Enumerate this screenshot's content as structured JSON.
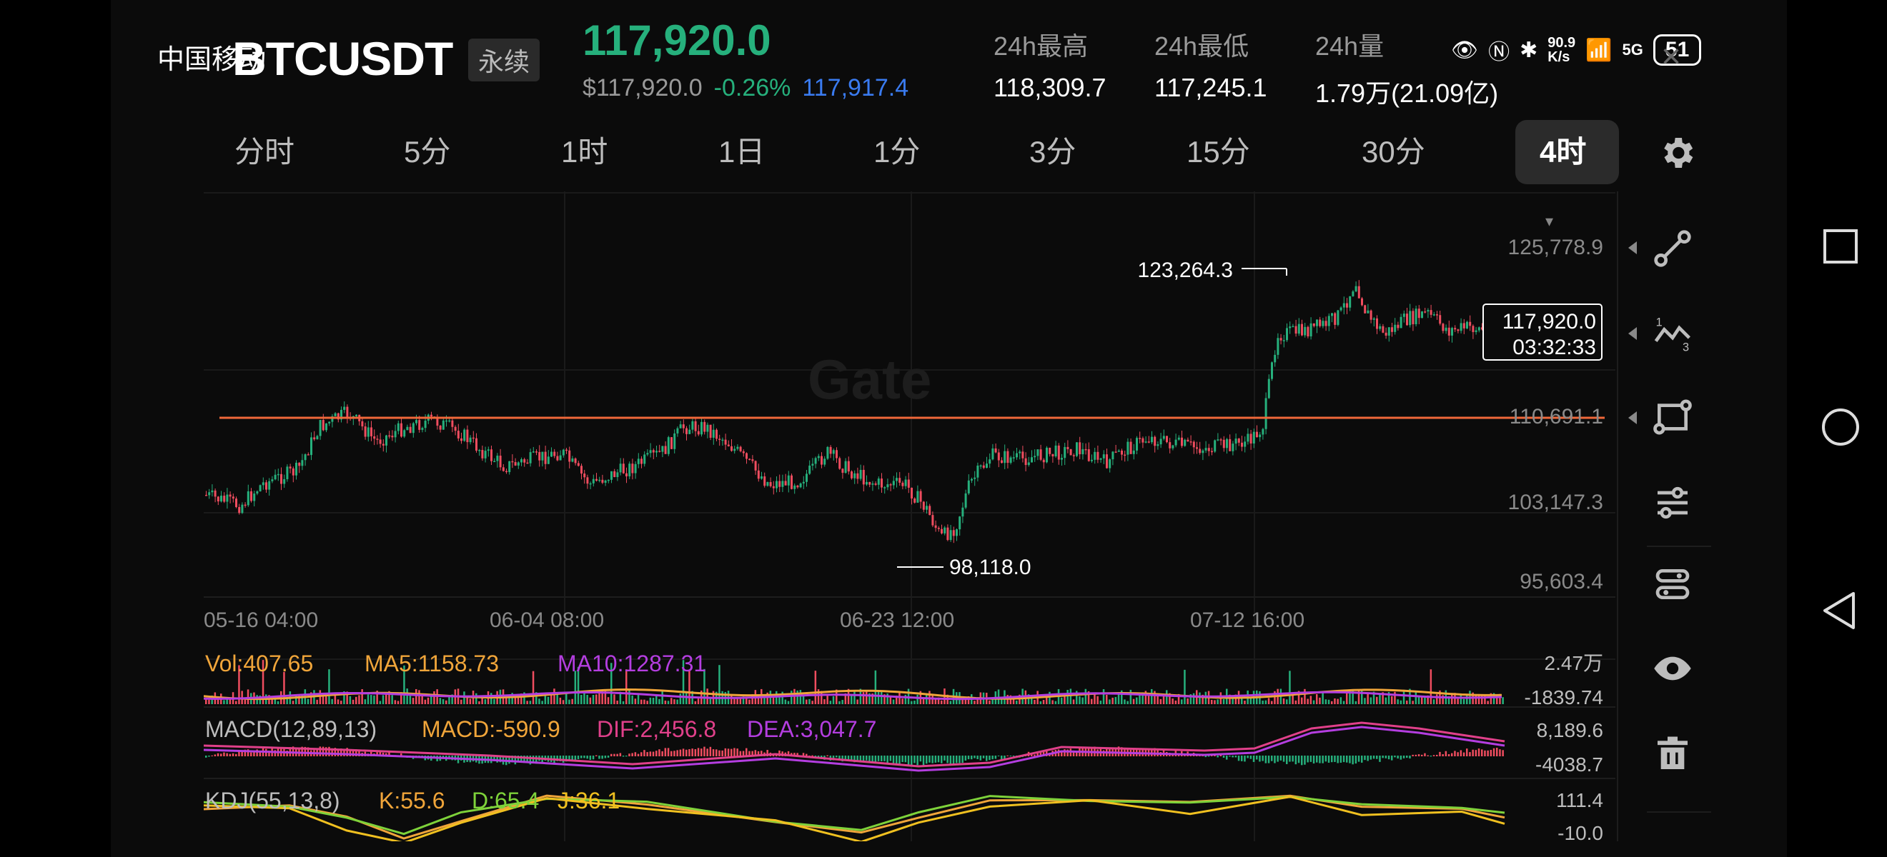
{
  "status_bar": {
    "carrier": "中国移动",
    "net_speed_top": "90.9",
    "net_speed_bottom": "K/s",
    "network": "5G",
    "battery": "51"
  },
  "header": {
    "symbol": "BTCUSDT",
    "contract_type": "永续",
    "last_price": "117,920.0",
    "usd_price": "$117,920.0",
    "change_pct": "-0.26%",
    "mark_price": "117,917.4",
    "high_label": "24h最高",
    "high_value": "118,309.7",
    "low_label": "24h最低",
    "low_value": "117,245.1",
    "vol_label": "24h量",
    "vol_value": "1.79万(21.09亿)"
  },
  "tabs": [
    "分时",
    "5分",
    "1时",
    "1日",
    "1分",
    "3分",
    "15分",
    "30分",
    "4时"
  ],
  "active_tab": "4时",
  "chart": {
    "watermark": "Gate",
    "price_axis": [
      "125,778.9",
      "110,691.1",
      "103,147.3",
      "95,603.4"
    ],
    "time_axis": [
      "05-16 04:00",
      "06-04 08:00",
      "06-23 12:00",
      "07-12 16:00"
    ],
    "high_marker": "123,264.3",
    "low_marker": "98,118.0",
    "current_price_box": "117,920.0",
    "countdown": "03:32:33",
    "vol": {
      "label": "Vol:407.65",
      "ma5": "MA5:1158.73",
      "ma10": "MA10:1287.31",
      "axis_top": "2.47万",
      "axis_bottom": "-1839.74"
    },
    "macd": {
      "label": "MACD(12,89,13)",
      "macd": "MACD:-590.9",
      "dif": "DIF:2,456.8",
      "dea": "DEA:3,047.7",
      "axis_top": "8,189.6",
      "axis_bottom": "-4038.7"
    },
    "kdj": {
      "label": "KDJ(55,13,8)",
      "k": "K:55.6",
      "d": "D:65.4",
      "j": "J:36.1",
      "axis_top": "111.4",
      "axis_bottom": "-10.0"
    }
  },
  "colors": {
    "up": "#26b07c",
    "down": "#ef4d5f",
    "accent_blue": "#3a7bf0",
    "hline": "#f0683a",
    "ma5": "#f0a53a",
    "ma10": "#b43ee0"
  },
  "toolbar_icons": [
    "trendline-icon",
    "fib-icon",
    "rectangle-icon",
    "indicator-settings-icon",
    "layers-icon",
    "eye-icon",
    "trash-icon"
  ]
}
